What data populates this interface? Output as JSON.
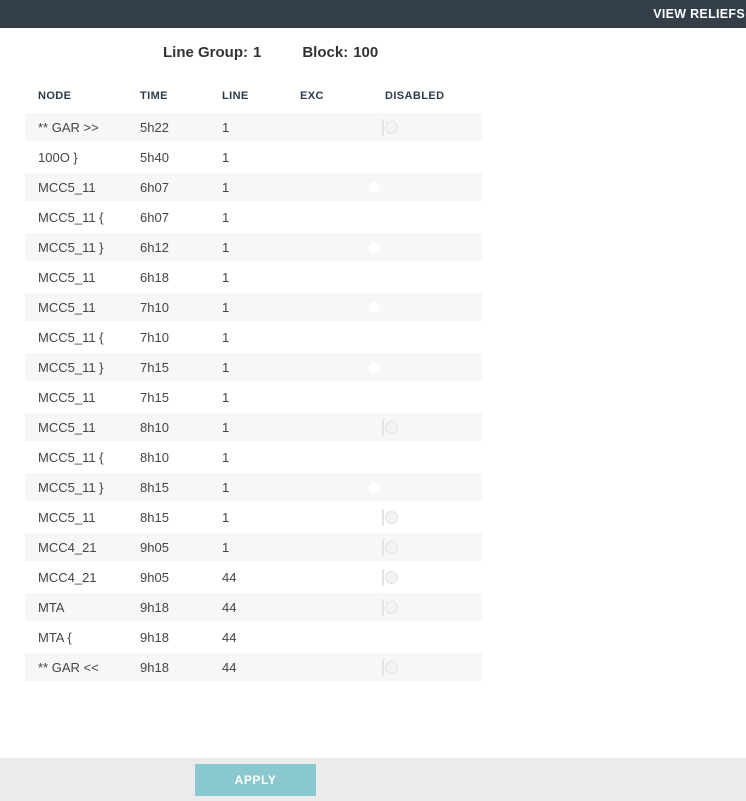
{
  "top_bar": {
    "view_reliefs_label": "VIEW RELIEFS"
  },
  "subheader": {
    "line_group_label": "Line Group:",
    "line_group_value": "1",
    "block_label": "Block:",
    "block_value": "100"
  },
  "table": {
    "columns": [
      "NODE",
      "TIME",
      "LINE",
      "EXC",
      "DISABLED"
    ],
    "rows": [
      {
        "node": "** GAR >>",
        "time": "5h22",
        "line": "1",
        "exc": "",
        "disabled_on": false
      },
      {
        "node": "100O }",
        "time": "5h40",
        "line": "1",
        "exc": "",
        "disabled_on": true
      },
      {
        "node": "MCC5_11",
        "time": "6h07",
        "line": "1",
        "exc": "",
        "disabled_on": true
      },
      {
        "node": "MCC5_11 {",
        "time": "6h07",
        "line": "1",
        "exc": "",
        "disabled_on": true
      },
      {
        "node": "MCC5_11 }",
        "time": "6h12",
        "line": "1",
        "exc": "",
        "disabled_on": true
      },
      {
        "node": "MCC5_11",
        "time": "6h18",
        "line": "1",
        "exc": "",
        "disabled_on": true
      },
      {
        "node": "MCC5_11",
        "time": "7h10",
        "line": "1",
        "exc": "",
        "disabled_on": true
      },
      {
        "node": "MCC5_11 {",
        "time": "7h10",
        "line": "1",
        "exc": "",
        "disabled_on": true
      },
      {
        "node": "MCC5_11 }",
        "time": "7h15",
        "line": "1",
        "exc": "",
        "disabled_on": true
      },
      {
        "node": "MCC5_11",
        "time": "7h15",
        "line": "1",
        "exc": "",
        "disabled_on": true
      },
      {
        "node": "MCC5_11",
        "time": "8h10",
        "line": "1",
        "exc": "",
        "disabled_on": false
      },
      {
        "node": "MCC5_11 {",
        "time": "8h10",
        "line": "1",
        "exc": "",
        "disabled_on": true
      },
      {
        "node": "MCC5_11 }",
        "time": "8h15",
        "line": "1",
        "exc": "",
        "disabled_on": true
      },
      {
        "node": "MCC5_11",
        "time": "8h15",
        "line": "1",
        "exc": "",
        "disabled_on": false
      },
      {
        "node": "MCC4_21",
        "time": "9h05",
        "line": "1",
        "exc": "",
        "disabled_on": false
      },
      {
        "node": "MCC4_21",
        "time": "9h05",
        "line": "44",
        "exc": "",
        "disabled_on": false
      },
      {
        "node": "MTA",
        "time": "9h18",
        "line": "44",
        "exc": "",
        "disabled_on": false
      },
      {
        "node": "MTA {",
        "time": "9h18",
        "line": "44",
        "exc": "",
        "disabled_on": true
      },
      {
        "node": "** GAR <<",
        "time": "9h18",
        "line": "44",
        "exc": "",
        "disabled_on": false
      }
    ]
  },
  "footer": {
    "apply_label": "APPLY"
  },
  "colors": {
    "top_bar": "#333e48",
    "accent_teal": "#1b9daa",
    "apply_button": "#8ac8d0",
    "row_stripe": "#f7f7f7",
    "footer_strip": "#ebebeb"
  }
}
